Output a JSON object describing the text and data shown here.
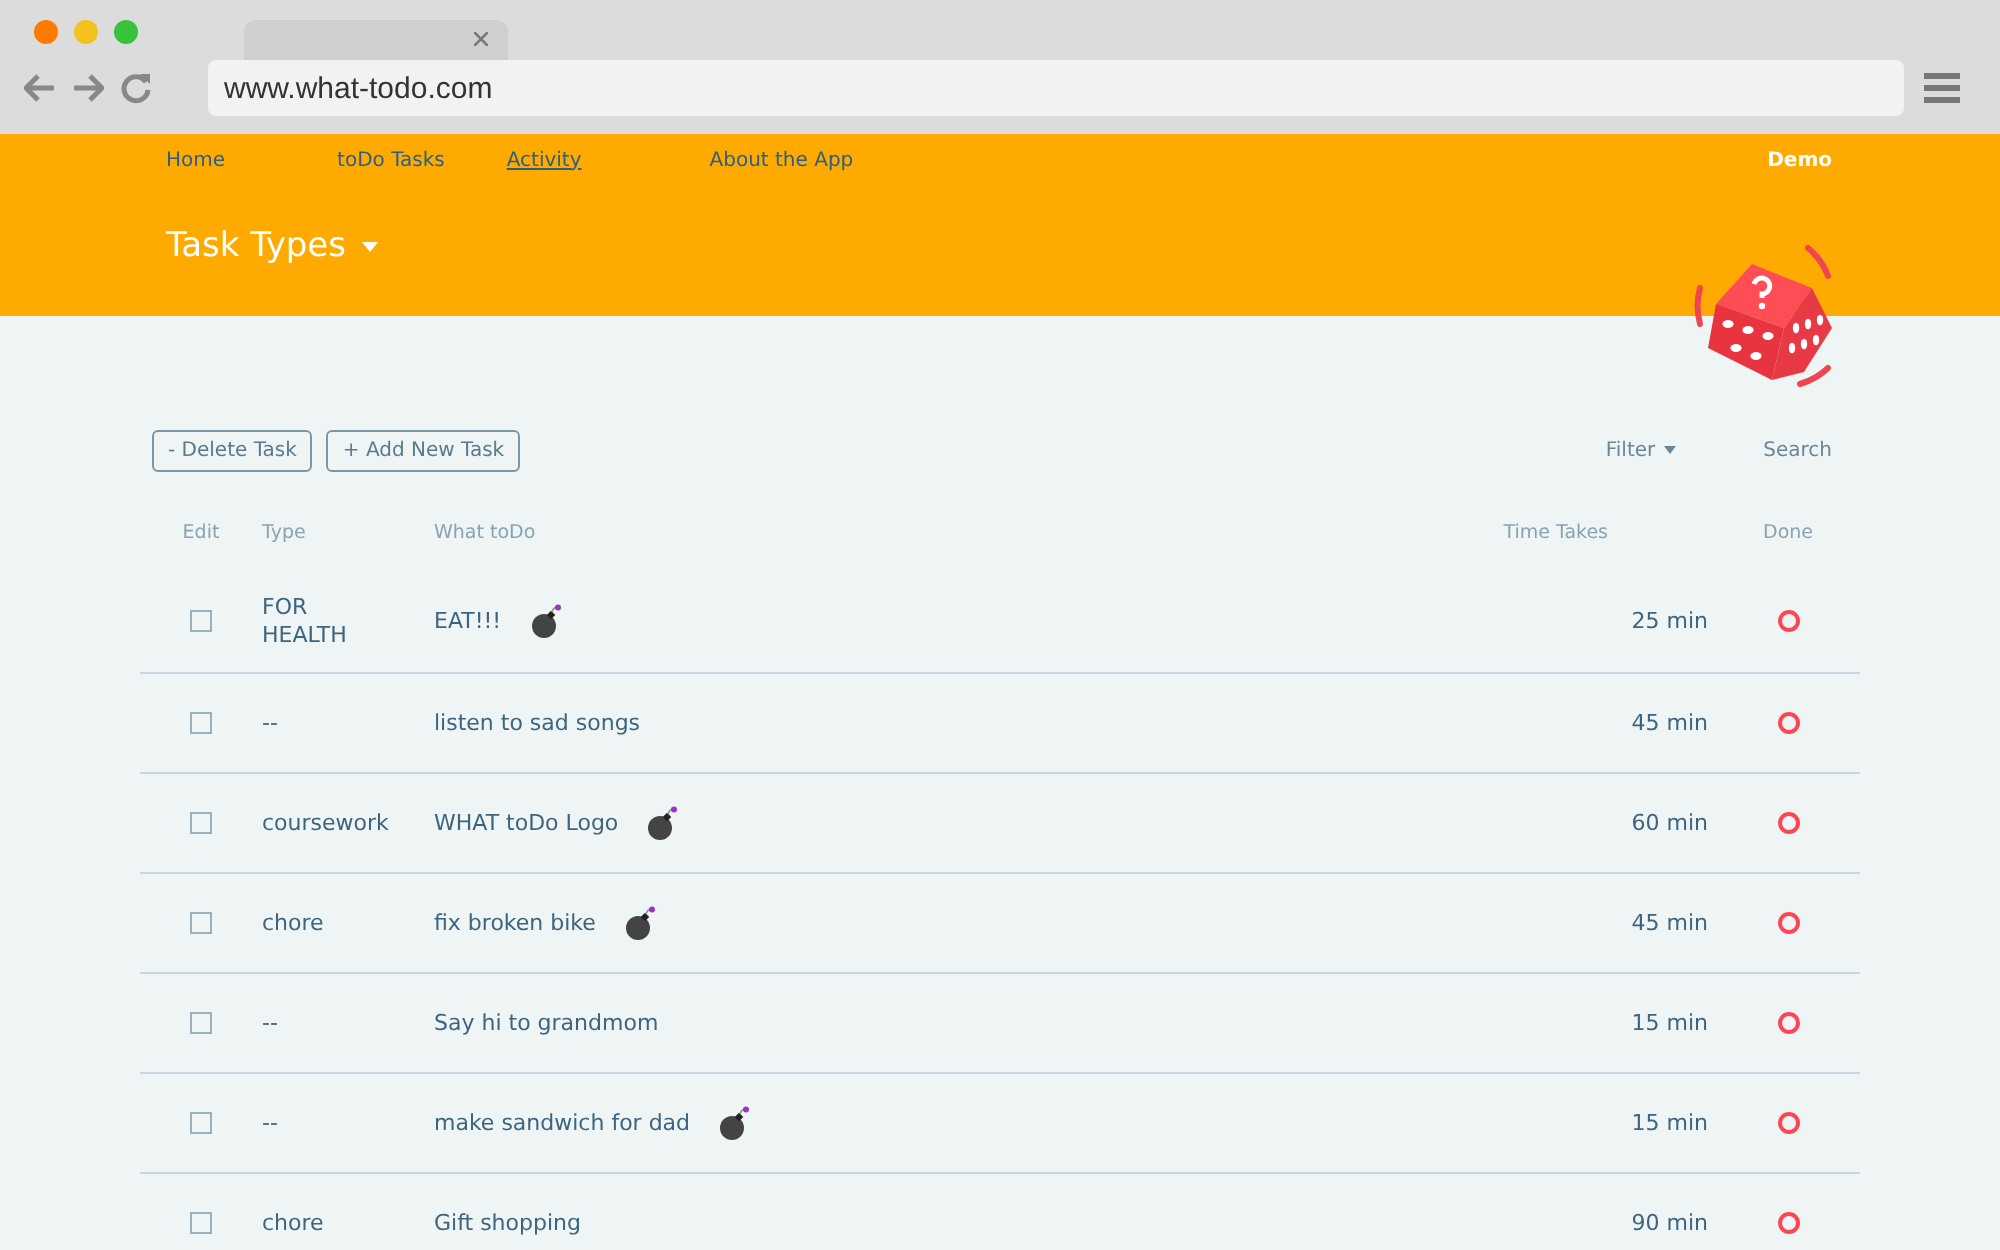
{
  "browser": {
    "url": "www.what-todo.com"
  },
  "nav": {
    "links": [
      {
        "label": "Home",
        "selected": false
      },
      {
        "label": "toDo Tasks",
        "selected": false
      },
      {
        "label": "Activity",
        "selected": true
      },
      {
        "label": "About the App",
        "selected": false
      }
    ],
    "user": "Demo"
  },
  "title": "Task Types",
  "toolbar": {
    "buttons": [
      "- Delete Task",
      "+ Add New Task"
    ],
    "filter": "Filter",
    "search": "Search"
  },
  "table": {
    "columns": [
      "Edit",
      "Type",
      "What toDo",
      "Time Takes",
      "Done"
    ],
    "rows": [
      {
        "checked": false,
        "type": "FOR HEALTH",
        "task": "EAT!!!",
        "urgent": true,
        "time": "25 min",
        "done": false
      },
      {
        "checked": false,
        "type": "--",
        "task": "listen to sad songs",
        "urgent": false,
        "time": "45 min",
        "done": false
      },
      {
        "checked": false,
        "type": "coursework",
        "task": "WHAT toDo Logo",
        "urgent": true,
        "time": "60 min",
        "done": false
      },
      {
        "checked": false,
        "type": "chore",
        "task": "fix broken bike",
        "urgent": true,
        "time": "45 min",
        "done": false
      },
      {
        "checked": false,
        "type": "--",
        "task": "Say hi to grandmom",
        "urgent": false,
        "time": "15 min",
        "done": false
      },
      {
        "checked": false,
        "type": "--",
        "task": "make sandwich for dad",
        "urgent": true,
        "time": "15 min",
        "done": false
      },
      {
        "checked": false,
        "type": "chore",
        "task": "Gift shopping",
        "urgent": false,
        "time": "90 min",
        "done": false
      }
    ]
  }
}
